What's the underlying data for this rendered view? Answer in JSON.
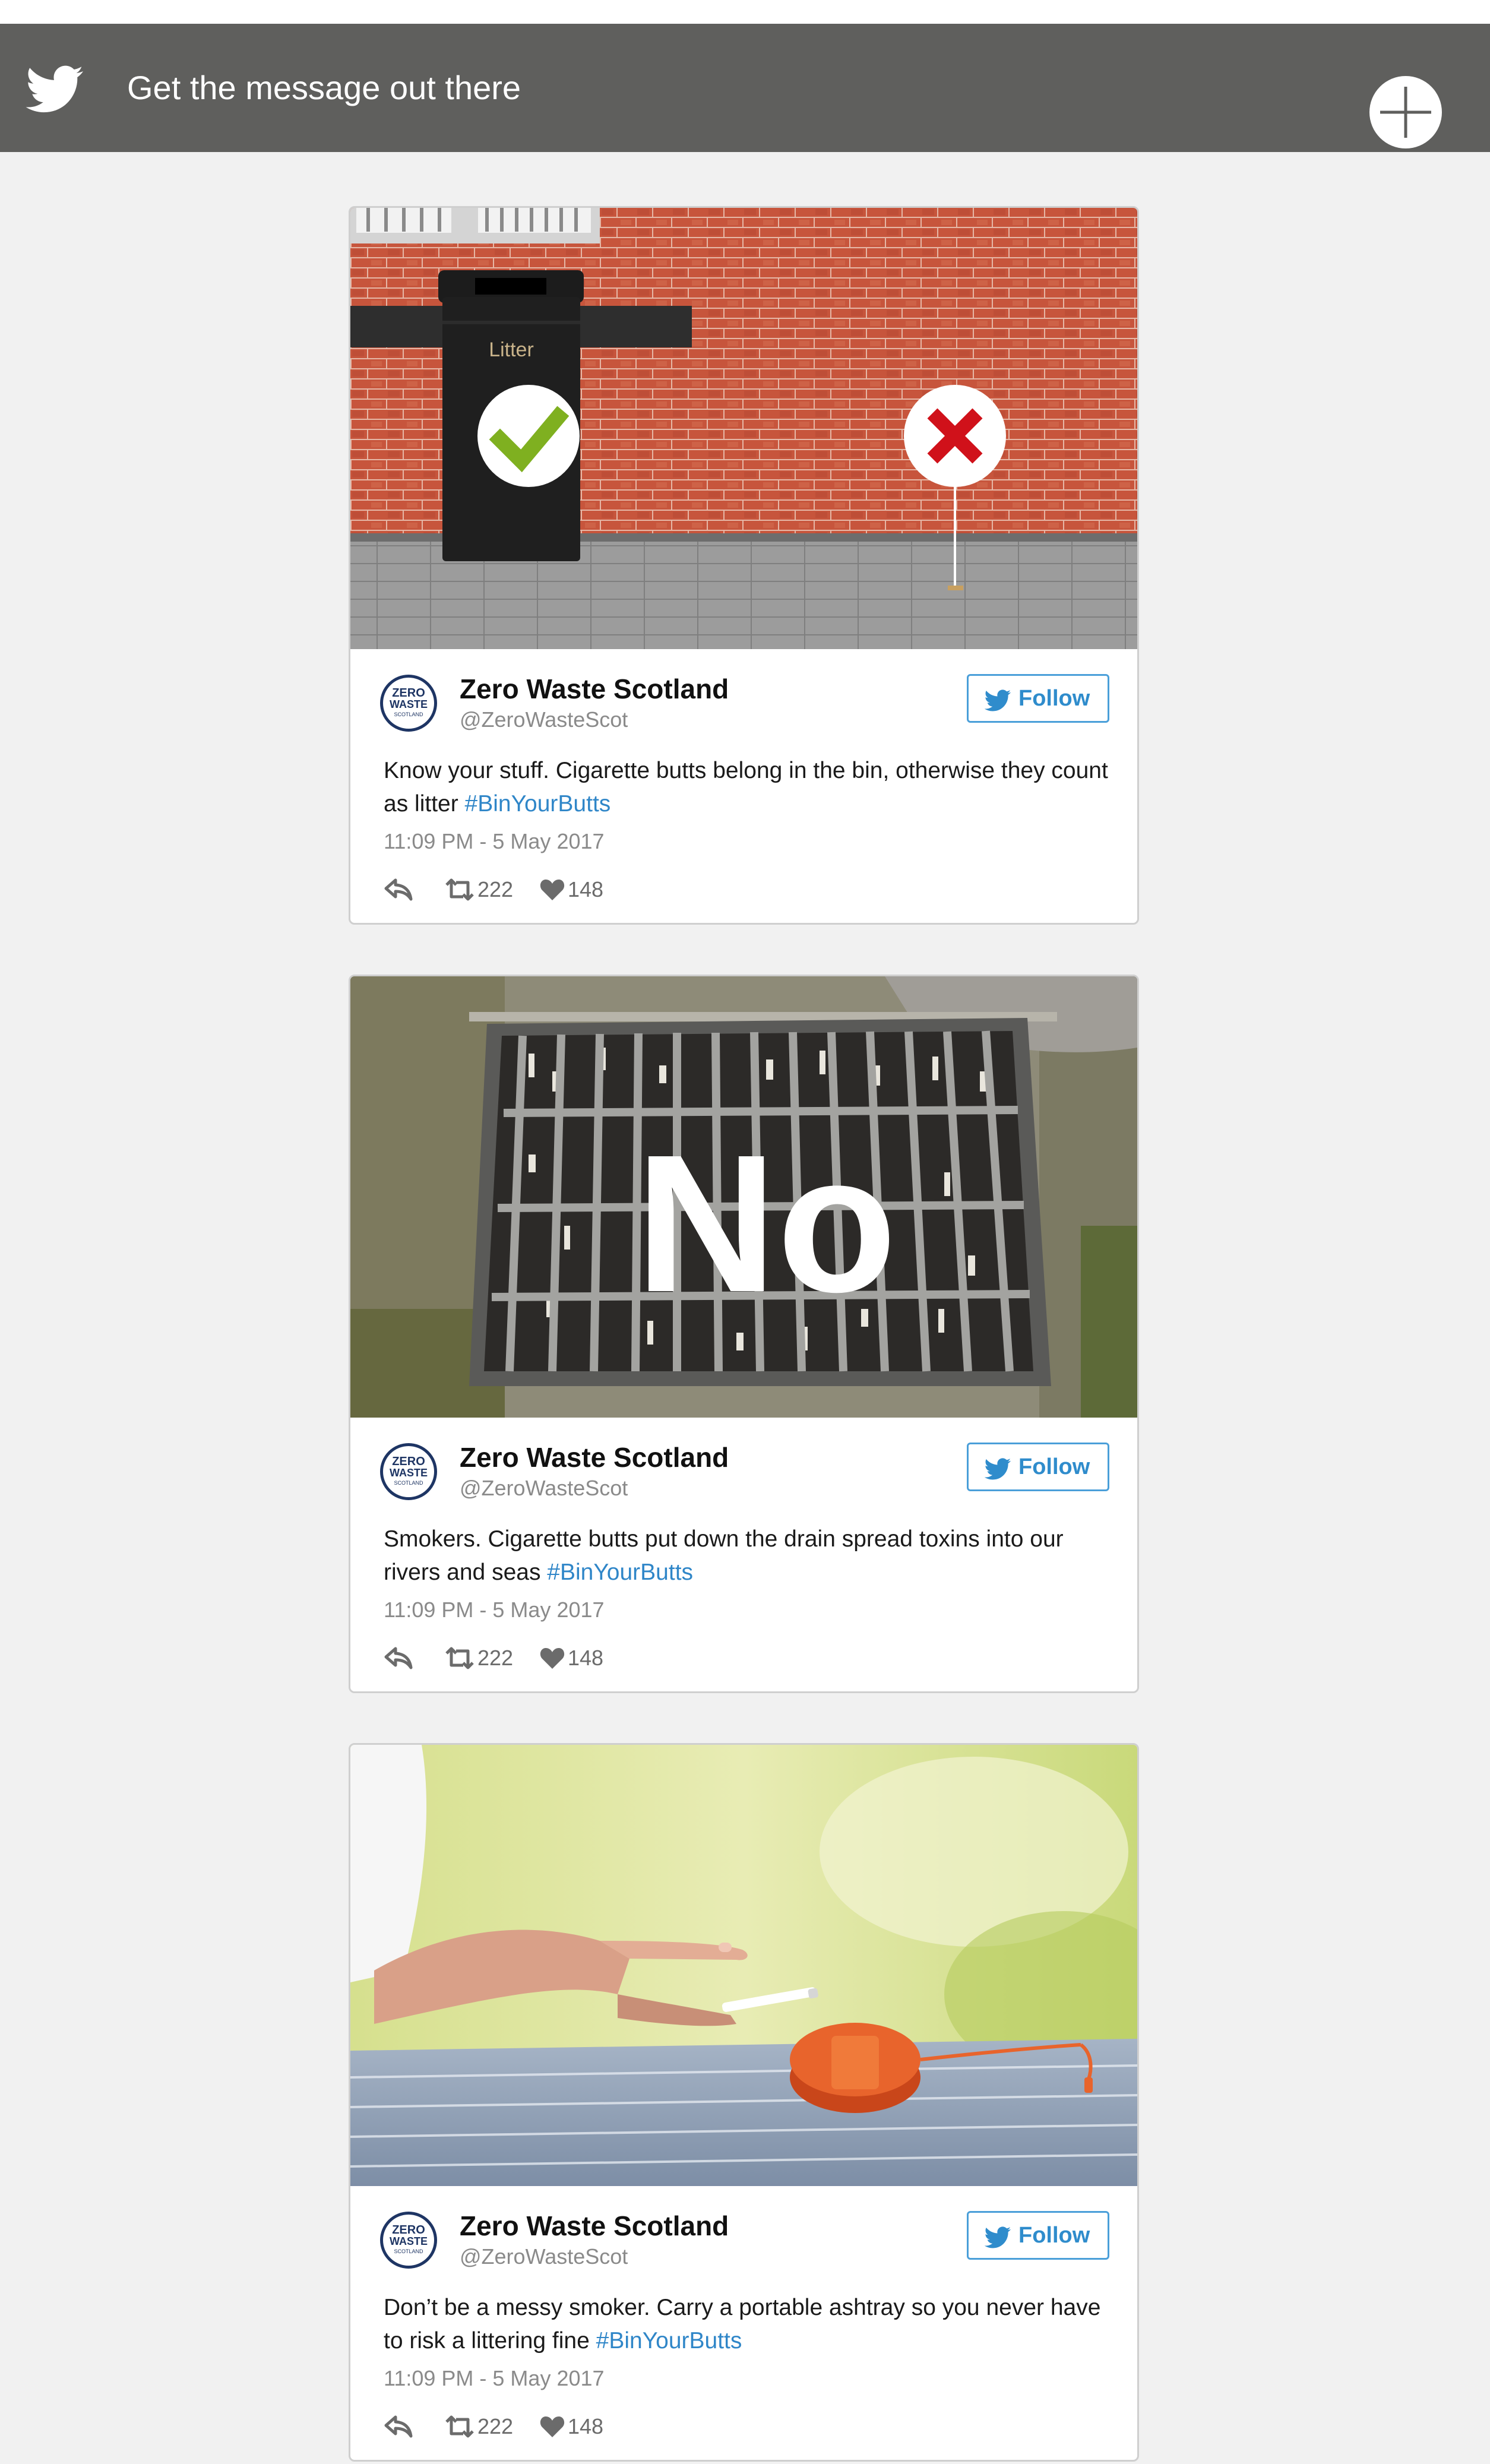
{
  "header": {
    "title": "Get the message out there",
    "bird_icon": "twitter-bird-icon",
    "add_icon": "plus-circle-icon",
    "background": "#5f5f5d"
  },
  "colors": {
    "link": "#2f86c8",
    "follow_border": "#4a9fd9",
    "logo_navy": "#1e3564"
  },
  "logo": {
    "line1": "ZERO",
    "line2": "WASTE",
    "line3": "SCOTLAND"
  },
  "tweets": [
    {
      "name": "Zero Waste Scotland",
      "handle": "@ZeroWasteScot",
      "follow_label": "Follow",
      "text": "Know your stuff. Cigarette butts belong in the bin, otherwise they count as litter",
      "hashtag": "#BinYourButts",
      "time": "11:09 PM - 5 May 2017",
      "retweets": "222",
      "likes": "148",
      "image": {
        "bin_label": "Litter"
      }
    },
    {
      "name": "Zero Waste Scotland",
      "handle": "@ZeroWasteScot",
      "follow_label": "Follow",
      "text": "Smokers. Cigarette butts put down the drain spread toxins into our rivers and seas",
      "hashtag": "#BinYourButts",
      "time": "11:09 PM - 5 May 2017",
      "retweets": "222",
      "likes": "148",
      "image": {
        "overlay_text": "No"
      }
    },
    {
      "name": "Zero Waste Scotland",
      "handle": "@ZeroWasteScot",
      "follow_label": "Follow",
      "text": "Don’t be a messy smoker. Carry a portable ashtray so you never have to risk a littering fine",
      "hashtag": "#BinYourButts",
      "time": "11:09 PM - 5 May 2017",
      "retweets": "222",
      "likes": "148",
      "image": {}
    }
  ]
}
